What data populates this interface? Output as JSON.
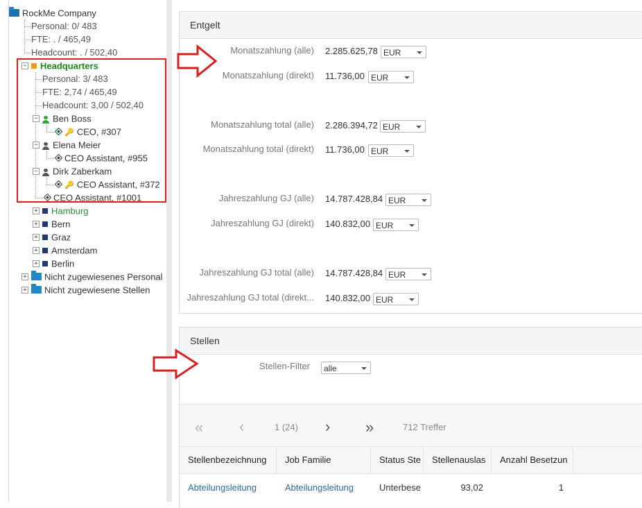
{
  "tree": {
    "root": {
      "label": "RockMe Company",
      "icon": "folder-open-icon"
    },
    "root_stats": [
      "Personal: 0/ 483",
      "FTE: . / 465,49",
      "Headcount: . / 502,40"
    ],
    "hq": {
      "label": "Headquarters",
      "color": "#f39c12"
    },
    "hq_stats": [
      "Personal: 3/ 483",
      "FTE: 2,74 / 465,49",
      "Headcount: 3,00 / 502,40"
    ],
    "people": [
      {
        "name": "Ben Boss",
        "position": "CEO, #307"
      },
      {
        "name": "Elena Meier",
        "position": "CEO Assistant, #955"
      },
      {
        "name": "Dirk Zaberkam",
        "position": "CEO Assistant, #372"
      }
    ],
    "vacant_position": "CEO Assistant, #1001",
    "branches": [
      "Hamburg",
      "Bern",
      "Graz",
      "Amsterdam",
      "Berlin"
    ],
    "unassigned": [
      "Nicht zugewiesenes Personal",
      "Nicht zugewiesene Stellen"
    ]
  },
  "entgelt": {
    "title": "Entgelt",
    "rows": [
      {
        "label": "Monatszahlung (alle)",
        "value": "2.285.625,78",
        "currency": "EUR"
      },
      {
        "label": "Monatszahlung (direkt)",
        "value": "11.736,00",
        "currency": "EUR"
      },
      {
        "label": "Monatszahlung total (alle)",
        "value": "2.286.394,72",
        "currency": "EUR"
      },
      {
        "label": "Monatszahlung total (direkt)",
        "value": "11.736,00",
        "currency": "EUR"
      },
      {
        "label": "Jahreszahlung GJ (alle)",
        "value": "14.787.428,84",
        "currency": "EUR"
      },
      {
        "label": "Jahreszahlung GJ (direkt)",
        "value": "140.832,00",
        "currency": "EUR"
      },
      {
        "label": "Jahreszahlung GJ total (alle)",
        "value": "14.787.428,84",
        "currency": "EUR"
      },
      {
        "label": "Jahreszahlung GJ total (direkt...",
        "value": "140.832,00",
        "currency": "EUR"
      }
    ]
  },
  "stellen": {
    "title": "Stellen",
    "filter_label": "Stellen-Filter",
    "filter_value": "alle",
    "pager": {
      "first": "«",
      "prev": "‹",
      "page": "1 (24)",
      "next": "›",
      "last": "»",
      "hits": "712 Treffer"
    },
    "columns": [
      "Stellenbezeichnung",
      "Job Familie",
      "Status Ste",
      "Stellenauslas",
      "Anzahl Besetzun"
    ],
    "rows": [
      {
        "title": "Abteilungsleitung",
        "family": "Abteilungsleitung",
        "status": "Unterbese",
        "load": "93,02",
        "count": "1"
      }
    ]
  },
  "colors": {
    "accent_red": "#d62020",
    "link": "#2c6ca0",
    "tree_green": "#1e8a1e",
    "navy": "#1f3b73"
  }
}
